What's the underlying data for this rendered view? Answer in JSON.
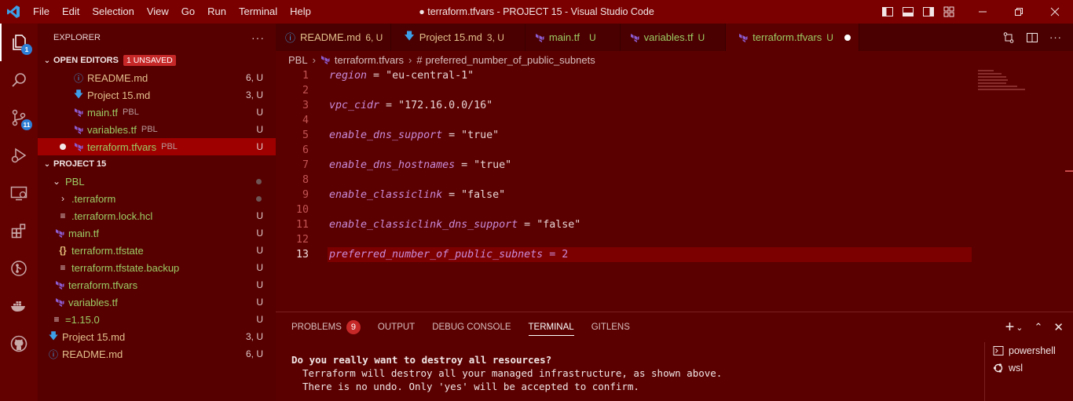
{
  "window": {
    "title": "● terraform.tfvars - PROJECT 15 - Visual Studio Code",
    "menu": [
      "File",
      "Edit",
      "Selection",
      "View",
      "Go",
      "Run",
      "Terminal",
      "Help"
    ]
  },
  "activity": {
    "explorer_badge": "1",
    "scm_badge": "11"
  },
  "sidebar": {
    "title": "EXPLORER",
    "more": "···",
    "open_editors": {
      "label": "OPEN EDITORS",
      "unsaved": "1 UNSAVED",
      "items": [
        {
          "name": "README.md",
          "desc": "",
          "status": "6, U"
        },
        {
          "name": "Project 15.md",
          "desc": "",
          "status": "3, U"
        },
        {
          "name": "main.tf",
          "desc": "PBL",
          "status": "U"
        },
        {
          "name": "variables.tf",
          "desc": "PBL",
          "status": "U"
        },
        {
          "name": "terraform.tfvars",
          "desc": "PBL",
          "status": "U"
        }
      ]
    },
    "project": {
      "label": "PROJECT 15",
      "items": [
        {
          "name": "PBL",
          "status": ""
        },
        {
          "name": ".terraform",
          "status": ""
        },
        {
          "name": ".terraform.lock.hcl",
          "status": "U"
        },
        {
          "name": "main.tf",
          "status": "U"
        },
        {
          "name": "terraform.tfstate",
          "status": "U"
        },
        {
          "name": "terraform.tfstate.backup",
          "status": "U"
        },
        {
          "name": "terraform.tfvars",
          "status": "U"
        },
        {
          "name": "variables.tf",
          "status": "U"
        },
        {
          "name": "=1.15.0",
          "status": "U"
        },
        {
          "name": "Project 15.md",
          "status": "3, U"
        },
        {
          "name": "README.md",
          "status": "6, U"
        }
      ]
    }
  },
  "tabs": [
    {
      "label": "README.md",
      "status": "6, U"
    },
    {
      "label": "Project 15.md",
      "status": "3, U"
    },
    {
      "label": "main.tf",
      "status": "U"
    },
    {
      "label": "variables.tf",
      "status": "U"
    },
    {
      "label": "terraform.tfvars",
      "status": "U"
    }
  ],
  "breadcrumb": [
    "PBL",
    "terraform.tfvars",
    "preferred_number_of_public_subnets"
  ],
  "code": [
    {
      "n": "1",
      "key": "region",
      "op": " = ",
      "val": "\"eu-central-1\""
    },
    {
      "n": "2",
      "key": "",
      "op": "",
      "val": ""
    },
    {
      "n": "3",
      "key": "vpc_cidr",
      "op": " = ",
      "val": "\"172.16.0.0/16\""
    },
    {
      "n": "4",
      "key": "",
      "op": "",
      "val": ""
    },
    {
      "n": "5",
      "key": "enable_dns_support",
      "op": " = ",
      "val": "\"true\""
    },
    {
      "n": "6",
      "key": "",
      "op": "",
      "val": ""
    },
    {
      "n": "7",
      "key": "enable_dns_hostnames",
      "op": " = ",
      "val": "\"true\""
    },
    {
      "n": "8",
      "key": "",
      "op": "",
      "val": ""
    },
    {
      "n": "9",
      "key": "enable_classiclink",
      "op": " = ",
      "val": "\"false\""
    },
    {
      "n": "10",
      "key": "",
      "op": "",
      "val": ""
    },
    {
      "n": "11",
      "key": "enable_classiclink_dns_support",
      "op": " = ",
      "val": "\"false\""
    },
    {
      "n": "12",
      "key": "",
      "op": "",
      "val": ""
    },
    {
      "n": "13",
      "key": "preferred_number_of_public_subnets",
      "op": " = ",
      "val": "2"
    }
  ],
  "panel": {
    "tabs": [
      "PROBLEMS",
      "OUTPUT",
      "DEBUG CONSOLE",
      "TERMINAL",
      "GITLENS"
    ],
    "problems_count": "9",
    "terminal_lines": [
      "Do you really want to destroy all resources?",
      "Terraform will destroy all your managed infrastructure, as shown above.",
      "There is no undo. Only 'yes' will be accepted to confirm."
    ],
    "terminals": [
      "powershell",
      "wsl"
    ]
  }
}
